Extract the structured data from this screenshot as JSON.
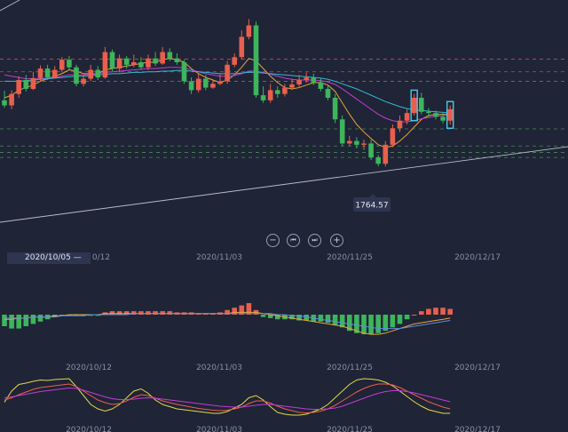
{
  "theme": {
    "background": "#1f2436",
    "up": "#e95f4d",
    "down": "#3db55c",
    "ma1": "#e8a53a",
    "ma2": "#c13dd6",
    "ma3": "#36b9cf",
    "grid_red": "#b05a4a",
    "grid_green": "#4a8a58",
    "trend": "#b8bcc8",
    "highlight": "#4fc6ea"
  },
  "controls": {
    "zoom_out_icon": "minus-icon",
    "prev_icon": "rewind-icon",
    "next_icon": "fast-forward-icon",
    "zoom_in_icon": "plus-icon",
    "zoom_out": "−",
    "prev": "⏮",
    "next": "⏭",
    "zoom_in": "+"
  },
  "cursor_label": "2020/10/05 —",
  "chart_data": [
    {
      "type": "candlestick",
      "x_axis_labels": [
        "0/12",
        "2020/11/03",
        "2020/11/25",
        "2020/12/17"
      ],
      "tooltip_value": "1764.57",
      "price_range": [
        1730,
        2010
      ],
      "candles": [
        [
          1880,
          1872,
          1895,
          1868
        ],
        [
          1872,
          1890,
          1896,
          1866
        ],
        [
          1890,
          1912,
          1918,
          1884
        ],
        [
          1912,
          1898,
          1920,
          1894
        ],
        [
          1898,
          1915,
          1925,
          1896
        ],
        [
          1915,
          1930,
          1935,
          1910
        ],
        [
          1930,
          1916,
          1936,
          1912
        ],
        [
          1916,
          1928,
          1934,
          1914
        ],
        [
          1928,
          1944,
          1948,
          1924
        ],
        [
          1944,
          1932,
          1950,
          1928
        ],
        [
          1932,
          1906,
          1936,
          1902
        ],
        [
          1906,
          1914,
          1920,
          1902
        ],
        [
          1914,
          1928,
          1936,
          1910
        ],
        [
          1928,
          1916,
          1934,
          1912
        ],
        [
          1916,
          1956,
          1964,
          1914
        ],
        [
          1956,
          1930,
          1960,
          1926
        ],
        [
          1930,
          1946,
          1952,
          1924
        ],
        [
          1946,
          1936,
          1950,
          1930
        ],
        [
          1936,
          1940,
          1952,
          1932
        ],
        [
          1940,
          1932,
          1948,
          1928
        ],
        [
          1932,
          1946,
          1952,
          1928
        ],
        [
          1946,
          1938,
          1956,
          1934
        ],
        [
          1938,
          1956,
          1964,
          1936
        ],
        [
          1956,
          1946,
          1962,
          1942
        ],
        [
          1946,
          1940,
          1954,
          1936
        ],
        [
          1940,
          1910,
          1944,
          1906
        ],
        [
          1910,
          1896,
          1916,
          1890
        ],
        [
          1896,
          1914,
          1922,
          1892
        ],
        [
          1914,
          1900,
          1920,
          1896
        ],
        [
          1900,
          1906,
          1912,
          1898
        ],
        [
          1906,
          1910,
          1922,
          1904
        ],
        [
          1910,
          1936,
          1942,
          1906
        ],
        [
          1936,
          1948,
          1954,
          1932
        ],
        [
          1948,
          1980,
          1990,
          1944
        ],
        [
          1980,
          1998,
          2008,
          1976
        ],
        [
          1998,
          1888,
          2004,
          1884
        ],
        [
          1888,
          1880,
          1902,
          1876
        ],
        [
          1880,
          1896,
          1906,
          1876
        ],
        [
          1896,
          1890,
          1902,
          1884
        ],
        [
          1890,
          1900,
          1906,
          1886
        ],
        [
          1900,
          1905,
          1914,
          1896
        ],
        [
          1905,
          1912,
          1920,
          1900
        ],
        [
          1912,
          1916,
          1924,
          1908
        ],
        [
          1916,
          1908,
          1922,
          1904
        ],
        [
          1908,
          1898,
          1914,
          1894
        ],
        [
          1898,
          1884,
          1904,
          1880
        ],
        [
          1884,
          1850,
          1890,
          1844
        ],
        [
          1850,
          1812,
          1856,
          1808
        ],
        [
          1812,
          1816,
          1824,
          1808
        ],
        [
          1816,
          1810,
          1822,
          1804
        ],
        [
          1810,
          1812,
          1818,
          1802
        ],
        [
          1812,
          1790,
          1818,
          1786
        ],
        [
          1790,
          1780,
          1794,
          1776
        ],
        [
          1780,
          1810,
          1816,
          1776
        ],
        [
          1810,
          1836,
          1842,
          1806
        ],
        [
          1836,
          1848,
          1856,
          1830
        ],
        [
          1848,
          1860,
          1866,
          1842
        ],
        [
          1860,
          1884,
          1890,
          1856
        ],
        [
          1884,
          1862,
          1892,
          1858
        ],
        [
          1862,
          1860,
          1868,
          1854
        ],
        [
          1860,
          1854,
          1864,
          1850
        ],
        [
          1854,
          1848,
          1860,
          1844
        ],
        [
          1848,
          1866,
          1872,
          1842
        ]
      ],
      "moving_averages": {
        "ma1": [
          1884,
          1888,
          1896,
          1900,
          1904,
          1910,
          1914,
          1918,
          1922,
          1928,
          1926,
          1922,
          1922,
          1922,
          1928,
          1930,
          1932,
          1934,
          1936,
          1938,
          1940,
          1940,
          1944,
          1946,
          1944,
          1940,
          1930,
          1922,
          1916,
          1912,
          1908,
          1912,
          1920,
          1932,
          1946,
          1942,
          1930,
          1918,
          1908,
          1900,
          1898,
          1900,
          1904,
          1908,
          1908,
          1904,
          1894,
          1876,
          1858,
          1842,
          1830,
          1820,
          1810,
          1806,
          1808,
          1816,
          1826,
          1838,
          1850,
          1856,
          1858,
          1858,
          1858
        ],
        "ma2": [
          1920,
          1918,
          1916,
          1914,
          1914,
          1914,
          1915,
          1916,
          1918,
          1920,
          1920,
          1920,
          1921,
          1922,
          1924,
          1925,
          1926,
          1927,
          1928,
          1929,
          1930,
          1930,
          1931,
          1932,
          1932,
          1931,
          1928,
          1925,
          1922,
          1920,
          1918,
          1918,
          1919,
          1922,
          1926,
          1926,
          1924,
          1921,
          1918,
          1915,
          1913,
          1912,
          1912,
          1912,
          1911,
          1909,
          1905,
          1898,
          1890,
          1882,
          1874,
          1866,
          1858,
          1852,
          1848,
          1846,
          1846,
          1848,
          1851,
          1853,
          1855,
          1856,
          1857
        ],
        "ma3": [
          1910,
          1910,
          1910,
          1911,
          1912,
          1913,
          1914,
          1915,
          1916,
          1917,
          1918,
          1918,
          1919,
          1920,
          1921,
          1922,
          1922,
          1923,
          1924,
          1924,
          1925,
          1925,
          1926,
          1926,
          1927,
          1927,
          1926,
          1925,
          1924,
          1923,
          1922,
          1922,
          1922,
          1923,
          1924,
          1924,
          1923,
          1922,
          1921,
          1920,
          1919,
          1918,
          1917,
          1916,
          1915,
          1913,
          1910,
          1906,
          1902,
          1898,
          1893,
          1888,
          1883,
          1878,
          1874,
          1870,
          1867,
          1865,
          1864,
          1863,
          1862,
          1861,
          1860
        ]
      },
      "highlight_boxes": [
        57,
        62
      ],
      "horizontal_levels": {
        "red": [
          1945,
          1925,
          1910
        ],
        "green": [
          1835,
          1808,
          1798,
          1790
        ]
      }
    },
    {
      "type": "bar",
      "name": "macd",
      "x_axis_labels": [
        "2020/10/12",
        "2020/11/03",
        "2020/11/25",
        "2020/12/17"
      ],
      "histogram": [
        -10,
        -12,
        -12,
        -10,
        -8,
        -6,
        -4,
        -2,
        -1,
        -1,
        -1,
        -1,
        -1,
        -1,
        2,
        3,
        3,
        3,
        3,
        3,
        3,
        3,
        3,
        3,
        2,
        2,
        2,
        1,
        1,
        1,
        2,
        4,
        6,
        8,
        10,
        4,
        -2,
        -3,
        -4,
        -4,
        -4,
        -5,
        -5,
        -6,
        -6,
        -7,
        -9,
        -11,
        -14,
        -16,
        -17,
        -17,
        -16,
        -14,
        -11,
        -8,
        -4,
        0,
        3,
        5,
        6,
        6,
        5
      ],
      "line_a": [
        -4,
        -4,
        -3,
        -3,
        -2,
        -2,
        -2,
        -1,
        -1,
        0,
        0,
        0,
        0,
        0,
        1,
        1,
        1,
        1,
        1,
        1,
        1,
        1,
        1,
        1,
        1,
        1,
        1,
        1,
        1,
        1,
        1,
        1,
        2,
        2,
        2,
        2,
        1,
        0,
        -1,
        -2,
        -3,
        -4,
        -5,
        -6,
        -7,
        -8,
        -9,
        -10,
        -12,
        -14,
        -16,
        -17,
        -17,
        -16,
        -14,
        -12,
        -10,
        -8,
        -7,
        -6,
        -5,
        -4,
        -3
      ],
      "line_b": [
        -3,
        -3,
        -3,
        -3,
        -2,
        -2,
        -2,
        -2,
        -1,
        -1,
        -1,
        -1,
        0,
        0,
        0,
        0,
        0,
        0,
        1,
        1,
        1,
        1,
        1,
        1,
        1,
        1,
        1,
        1,
        1,
        1,
        1,
        1,
        1,
        1,
        1,
        1,
        1,
        1,
        0,
        0,
        -1,
        -1,
        -2,
        -3,
        -4,
        -5,
        -6,
        -7,
        -8,
        -9,
        -10,
        -11,
        -12,
        -12,
        -12,
        -12,
        -11,
        -10,
        -9,
        -8,
        -7,
        -6,
        -5
      ]
    },
    {
      "type": "line",
      "name": "kdj",
      "x_axis_labels": [
        "2020/10/12",
        "2020/11/03",
        "2020/11/25",
        "2020/12/17"
      ],
      "series": [
        {
          "color": "#e2d94a",
          "values": [
            45,
            70,
            85,
            88,
            92,
            95,
            94,
            96,
            97,
            98,
            80,
            60,
            40,
            30,
            25,
            30,
            40,
            55,
            70,
            75,
            65,
            50,
            40,
            35,
            30,
            28,
            26,
            24,
            22,
            20,
            20,
            24,
            32,
            40,
            55,
            60,
            50,
            35,
            22,
            18,
            16,
            16,
            18,
            24,
            30,
            40,
            55,
            70,
            85,
            95,
            98,
            97,
            95,
            90,
            82,
            70,
            58,
            46,
            36,
            28,
            24,
            20,
            20
          ]
        },
        {
          "color": "#e95f4d",
          "values": [
            50,
            55,
            62,
            68,
            74,
            78,
            80,
            82,
            84,
            86,
            80,
            70,
            60,
            50,
            44,
            40,
            42,
            48,
            56,
            62,
            60,
            54,
            48,
            44,
            40,
            37,
            34,
            31,
            29,
            27,
            26,
            27,
            30,
            34,
            42,
            48,
            48,
            43,
            36,
            30,
            26,
            22,
            21,
            22,
            25,
            30,
            38,
            48,
            58,
            68,
            76,
            82,
            86,
            86,
            84,
            78,
            70,
            62,
            54,
            46,
            40,
            34,
            30
          ]
        },
        {
          "color": "#c13dd6",
          "values": [
            55,
            57,
            60,
            63,
            66,
            69,
            71,
            73,
            75,
            77,
            76,
            72,
            67,
            62,
            57,
            53,
            51,
            51,
            52,
            54,
            55,
            54,
            52,
            50,
            48,
            46,
            44,
            42,
            40,
            38,
            36,
            35,
            34,
            34,
            36,
            38,
            40,
            40,
            38,
            36,
            34,
            32,
            30,
            29,
            29,
            30,
            32,
            36,
            42,
            48,
            54,
            60,
            65,
            69,
            71,
            71,
            69,
            66,
            62,
            58,
            54,
            50,
            46
          ]
        }
      ]
    }
  ]
}
